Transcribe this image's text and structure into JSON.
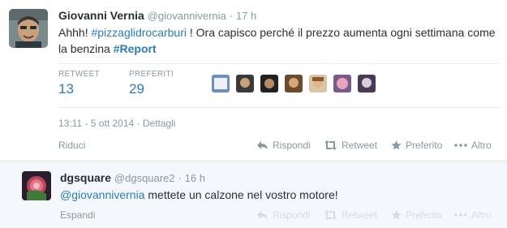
{
  "tweet": {
    "fullname": "Giovanni Vernia",
    "username": "@giovannivernia",
    "separator": "·",
    "time": "17 h",
    "text_before": "Ahhh! ",
    "hashtag_1": "#pizzaglidrocarburi",
    "text_middle": " ! Ora capisco perché il prezzo aumenta ogni settimana come la benzina ",
    "hashtag_2": "#Report",
    "stats": {
      "retweet_label": "RETWEET",
      "retweet_count": "13",
      "favorites_label": "PREFERITI",
      "favorites_count": "29"
    },
    "favoriter_avatars": 7,
    "datetime": "13:11 - 5 ott 2014",
    "details_link": "Dettagli",
    "actions": {
      "collapse": "Riduci",
      "reply": "Rispondi",
      "retweet": "Retweet",
      "favorite": "Preferito",
      "more": "Altro"
    }
  },
  "reply": {
    "fullname": "dgsquare",
    "username": "@dgsquare2",
    "separator": "·",
    "time": "16 h",
    "mention": "@giovannivernia",
    "text": " mettete un calzone nel vostro motore!",
    "actions": {
      "expand": "Espandi",
      "reply": "Rispondi",
      "retweet": "Retweet",
      "favorite": "Preferito",
      "more": "Altro"
    }
  },
  "colors": {
    "link": "#2b7bb9",
    "muted": "#8899a6",
    "text": "#292f33",
    "reply_background": "#f5f8fa"
  }
}
